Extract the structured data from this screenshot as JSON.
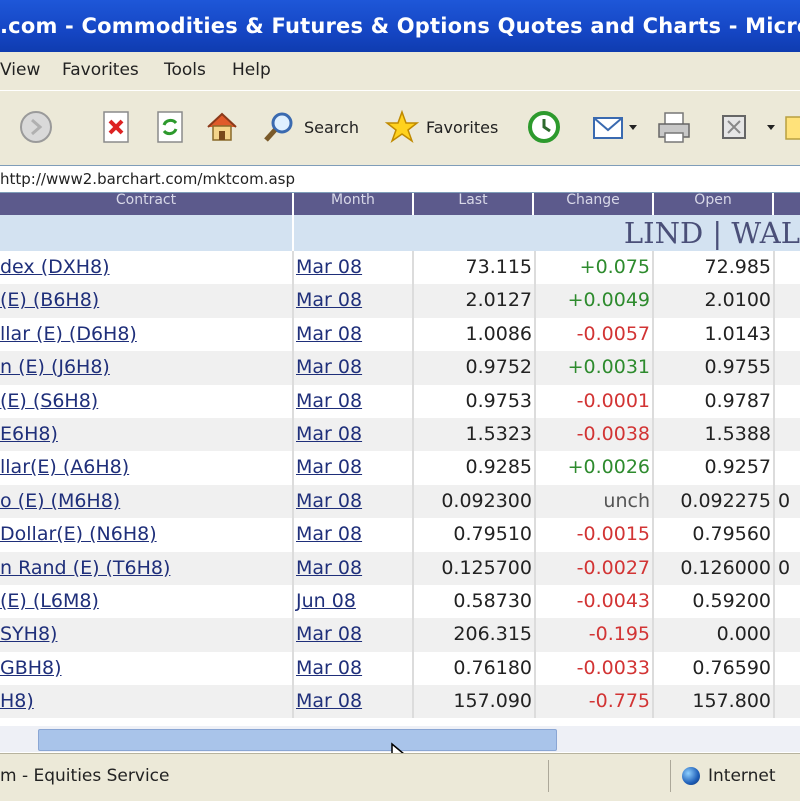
{
  "window": {
    "title": ".com - Commodities & Futures & Options Quotes and Charts - Microsoft Inte..."
  },
  "menu": [
    "View",
    "Favorites",
    "Tools",
    "Help"
  ],
  "toolbar": {
    "search_label": "Search",
    "favorites_label": "Favorites"
  },
  "address": {
    "url": "http://www2.barchart.com/mktcom.asp"
  },
  "table": {
    "headers": [
      "Contract",
      "Month",
      "Last",
      "Change",
      "Open"
    ],
    "banner": "LIND | WAL",
    "rows": [
      {
        "name": "dex (DXH8)",
        "month": "Mar 08",
        "last": "73.115",
        "change": "+0.075",
        "dir": "pos",
        "open": "72.985",
        "more": ""
      },
      {
        "name": "(E) (B6H8)",
        "month": "Mar 08",
        "last": "2.0127",
        "change": "+0.0049",
        "dir": "pos",
        "open": "2.0100",
        "more": ""
      },
      {
        "name": "llar (E) (D6H8)",
        "month": "Mar 08",
        "last": "1.0086",
        "change": "-0.0057",
        "dir": "neg",
        "open": "1.0143",
        "more": ""
      },
      {
        "name": "n (E) (J6H8)",
        "month": "Mar 08",
        "last": "0.9752",
        "change": "+0.0031",
        "dir": "pos",
        "open": "0.9755",
        "more": ""
      },
      {
        "name": "(E) (S6H8)",
        "month": "Mar 08",
        "last": "0.9753",
        "change": "-0.0001",
        "dir": "neg",
        "open": "0.9787",
        "more": ""
      },
      {
        "name": "E6H8)",
        "month": "Mar 08",
        "last": "1.5323",
        "change": "-0.0038",
        "dir": "neg",
        "open": "1.5388",
        "more": ""
      },
      {
        "name": "llar(E) (A6H8)",
        "month": "Mar 08",
        "last": "0.9285",
        "change": "+0.0026",
        "dir": "pos",
        "open": "0.9257",
        "more": ""
      },
      {
        "name": "o (E) (M6H8)",
        "month": "Mar 08",
        "last": "0.092300",
        "change": "unch",
        "dir": "unch",
        "open": "0.092275",
        "more": "0"
      },
      {
        "name": "Dollar(E) (N6H8)",
        "month": "Mar 08",
        "last": "0.79510",
        "change": "-0.0015",
        "dir": "neg",
        "open": "0.79560",
        "more": ""
      },
      {
        "name": "n Rand (E) (T6H8)",
        "month": "Mar 08",
        "last": "0.125700",
        "change": "-0.0027",
        "dir": "neg",
        "open": "0.126000",
        "more": "0"
      },
      {
        "name": "(E) (L6M8)",
        "month": "Jun 08",
        "last": "0.58730",
        "change": "-0.0043",
        "dir": "neg",
        "open": "0.59200",
        "more": ""
      },
      {
        "name": "SYH8)",
        "month": "Mar 08",
        "last": "206.315",
        "change": "-0.195",
        "dir": "neg",
        "open": "0.000",
        "more": ""
      },
      {
        "name": "GBH8)",
        "month": "Mar 08",
        "last": "0.76180",
        "change": "-0.0033",
        "dir": "neg",
        "open": "0.76590",
        "more": ""
      },
      {
        "name": "H8)",
        "month": "Mar 08",
        "last": "157.090",
        "change": "-0.775",
        "dir": "neg",
        "open": "157.800",
        "more": ""
      }
    ]
  },
  "status": {
    "text": "m - Equities Service",
    "zone": "Internet"
  },
  "colors": {
    "titlebar": "#1546c4",
    "header": "#5c5a8c",
    "banner": "#d3e2f1",
    "positive": "#2e8b2e",
    "negative": "#d23434",
    "link": "#1f2f7a"
  }
}
